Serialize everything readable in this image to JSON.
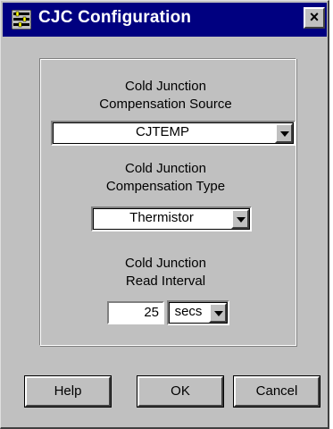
{
  "window": {
    "title": "CJC Configuration",
    "close_glyph": "×",
    "title_icon": "config-icon"
  },
  "source": {
    "label_line1": "Cold Junction",
    "label_line2": "Compensation Source",
    "value": "CJTEMP"
  },
  "type": {
    "label_line1": "Cold Junction",
    "label_line2": "Compensation Type",
    "value": "Thermistor"
  },
  "interval": {
    "label_line1": "Cold Junction",
    "label_line2": "Read Interval",
    "value": "25",
    "unit": "secs"
  },
  "buttons": {
    "help": "Help",
    "ok": "OK",
    "cancel": "Cancel"
  },
  "colors": {
    "titlebar": "#000080",
    "face": "#c0c0c0"
  }
}
